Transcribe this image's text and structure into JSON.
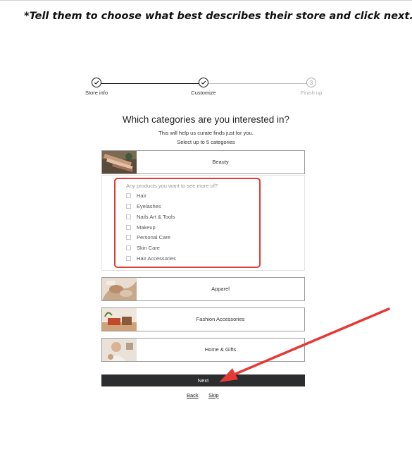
{
  "instruction": "*Tell them to choose what best describes their store and click next.",
  "stepper": {
    "steps": [
      {
        "label": "Store info",
        "state": "complete"
      },
      {
        "label": "Customize",
        "state": "complete"
      },
      {
        "label": "Finish up",
        "state": "pending",
        "number": "3"
      }
    ]
  },
  "form": {
    "heading": "Which categories are you interested in?",
    "subtitle": "This will help us curate finds just for you.",
    "hint": "Select up to 5 categories",
    "categories": [
      {
        "label": "Beauty",
        "expanded": true
      },
      {
        "label": "Apparel"
      },
      {
        "label": "Fashion Accessories"
      },
      {
        "label": "Home & Gifts"
      }
    ],
    "panel": {
      "question": "Any products you want to see more of?",
      "options": [
        "Hair",
        "Eyelashes",
        "Nails Art & Tools",
        "Makeup",
        "Personal Care",
        "Skin Care",
        "Hair Accessories"
      ]
    },
    "next_label": "Next",
    "back_label": "Back",
    "skip_label": "Skip"
  },
  "colors": {
    "annotation": "#e53935",
    "button_bg": "#2b2d2f",
    "card_border": "#9c9c9c"
  },
  "icons": {
    "complete_step": "check-icon",
    "annotation": "red-arrow"
  }
}
